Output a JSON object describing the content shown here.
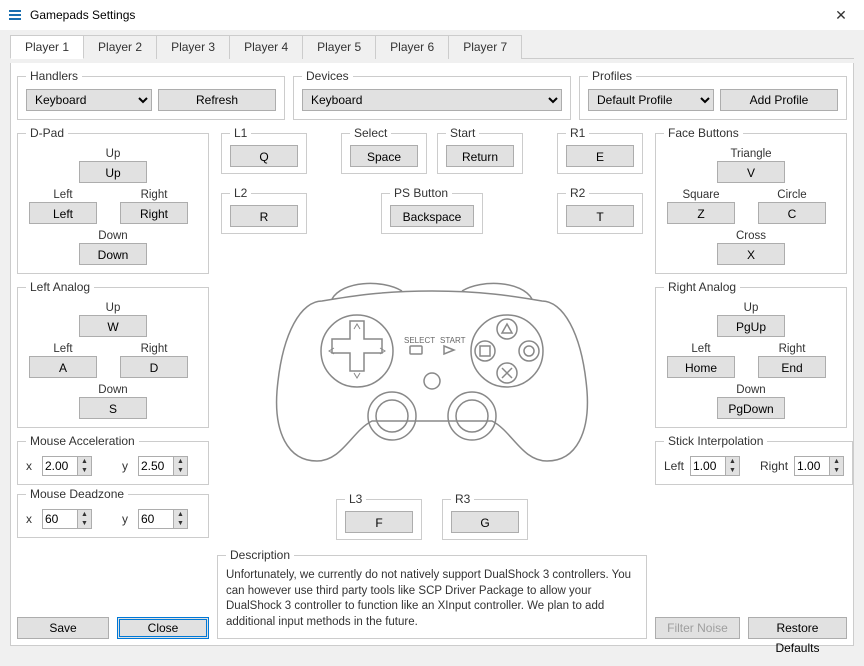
{
  "window": {
    "title": "Gamepads Settings"
  },
  "tabs": [
    "Player 1",
    "Player 2",
    "Player 3",
    "Player 4",
    "Player 5",
    "Player 6",
    "Player 7"
  ],
  "active_tab": 0,
  "handlers": {
    "legend": "Handlers",
    "value": "Keyboard",
    "refresh": "Refresh"
  },
  "devices": {
    "legend": "Devices",
    "value": "Keyboard"
  },
  "profiles": {
    "legend": "Profiles",
    "value": "Default Profile",
    "add": "Add Profile"
  },
  "dpad": {
    "legend": "D-Pad",
    "up": {
      "label": "Up",
      "value": "Up"
    },
    "left": {
      "label": "Left",
      "value": "Left"
    },
    "right": {
      "label": "Right",
      "value": "Right"
    },
    "down": {
      "label": "Down",
      "value": "Down"
    }
  },
  "left_analog": {
    "legend": "Left Analog",
    "up": {
      "label": "Up",
      "value": "W"
    },
    "left": {
      "label": "Left",
      "value": "A"
    },
    "right": {
      "label": "Right",
      "value": "D"
    },
    "down": {
      "label": "Down",
      "value": "S"
    }
  },
  "right_analog": {
    "legend": "Right Analog",
    "up": {
      "label": "Up",
      "value": "PgUp"
    },
    "left": {
      "label": "Left",
      "value": "Home"
    },
    "right": {
      "label": "Right",
      "value": "End"
    },
    "down": {
      "label": "Down",
      "value": "PgDown"
    }
  },
  "face": {
    "legend": "Face Buttons",
    "triangle": {
      "label": "Triangle",
      "value": "V"
    },
    "square": {
      "label": "Square",
      "value": "Z"
    },
    "circle": {
      "label": "Circle",
      "value": "C"
    },
    "cross": {
      "label": "Cross",
      "value": "X"
    }
  },
  "l1": {
    "label": "L1",
    "value": "Q"
  },
  "l2": {
    "label": "L2",
    "value": "R"
  },
  "r1": {
    "label": "R1",
    "value": "E"
  },
  "r2": {
    "label": "R2",
    "value": "T"
  },
  "select": {
    "label": "Select",
    "value": "Space"
  },
  "start": {
    "label": "Start",
    "value": "Return"
  },
  "psbutton": {
    "label": "PS Button",
    "value": "Backspace"
  },
  "l3": {
    "label": "L3",
    "value": "F"
  },
  "r3": {
    "label": "R3",
    "value": "G"
  },
  "mouse_accel": {
    "legend": "Mouse Acceleration",
    "x_label": "x",
    "x": "2.00",
    "y_label": "y",
    "y": "2.50"
  },
  "mouse_dead": {
    "legend": "Mouse Deadzone",
    "x_label": "x",
    "x": "60",
    "y_label": "y",
    "y": "60"
  },
  "stick_interp": {
    "legend": "Stick Interpolation",
    "left_label": "Left",
    "left": "1.00",
    "right_label": "Right",
    "right": "1.00"
  },
  "description": {
    "legend": "Description",
    "text": "Unfortunately, we currently do not natively support DualShock 3 controllers. You can however use third party tools like SCP Driver Package to allow your DualShock 3 controller to function like an XInput controller. We plan to add additional input methods in the future."
  },
  "footer": {
    "save": "Save",
    "close": "Close",
    "filter": "Filter Noise",
    "restore": "Restore Defaults"
  },
  "svg_text": {
    "select": "SELECT",
    "start": "START"
  }
}
